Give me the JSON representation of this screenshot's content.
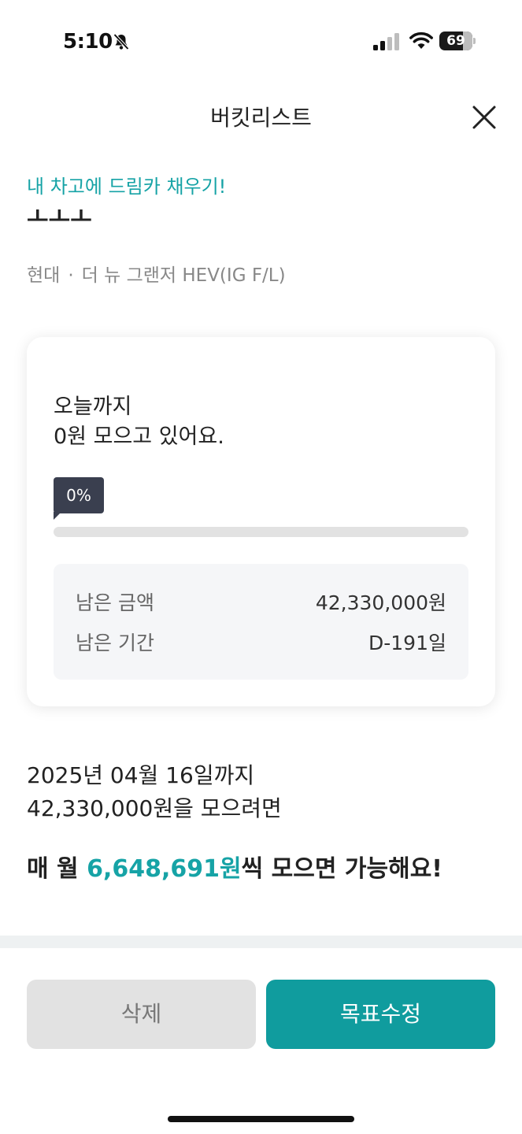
{
  "status_bar": {
    "time": "5:10",
    "battery_level": "69"
  },
  "nav": {
    "title": "버킷리스트"
  },
  "goal": {
    "subtitle": "내 차고에 드림카 채우기!",
    "title": "ㅗㅗㅗ",
    "brand": "현대",
    "model": "더 뉴 그랜저 HEV(IG F/L)"
  },
  "card": {
    "heading_line1": "오늘까지",
    "heading_line2": "0원 모으고 있어요.",
    "progress_label": "0%",
    "progress_percent": 0,
    "remaining_amount_label": "남은 금액",
    "remaining_amount_value": "42,330,000원",
    "remaining_period_label": "남은 기간",
    "remaining_period_value": "D-191일"
  },
  "summary": {
    "target_date": "2025년 04월 16일",
    "date_suffix": "까지",
    "target_amount": "42,330,000원",
    "amount_suffix": "을 모으려면",
    "monthly_prefix": "매 월 ",
    "monthly_amount": "6,648,691원",
    "monthly_suffix": "씩 모으면 가능해요!"
  },
  "buttons": {
    "delete_label": "삭제",
    "edit_label": "목표수정"
  },
  "colors": {
    "accent": "#16a3a6",
    "primary_button": "#109c9e",
    "highlight": "#a7ecef",
    "tag": "#3a3f4f"
  }
}
